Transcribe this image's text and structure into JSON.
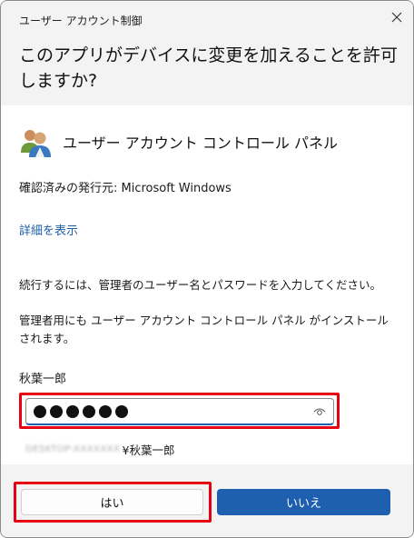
{
  "window": {
    "title": "ユーザー アカウント制御",
    "question": "このアプリがデバイスに変更を加えることを許可しますか?"
  },
  "app": {
    "name": "ユーザー アカウント コントロール パネル",
    "icon": "users-icon",
    "publisher": "確認済みの発行元: Microsoft Windows",
    "details_link": "詳細を表示"
  },
  "messages": {
    "instruction": "続行するには、管理者のユーザー名とパスワードを入力してください。",
    "note": "管理者用にも ユーザー アカウント コントロール パネル がインストールされます。"
  },
  "credentials": {
    "username": "秋葉一郎",
    "password_masked": "●●●●●●",
    "password_length": 6,
    "domain_blurred": "DESKTOP-XXXXXXX",
    "domain_user": "¥秋葉一郎"
  },
  "buttons": {
    "yes_label": "はい",
    "no_label": "いいえ"
  },
  "colors": {
    "accent": "#1f5fb0",
    "highlight": "#e60012",
    "link": "#1c5fa8",
    "panel_bg": "#f3f3f3"
  }
}
